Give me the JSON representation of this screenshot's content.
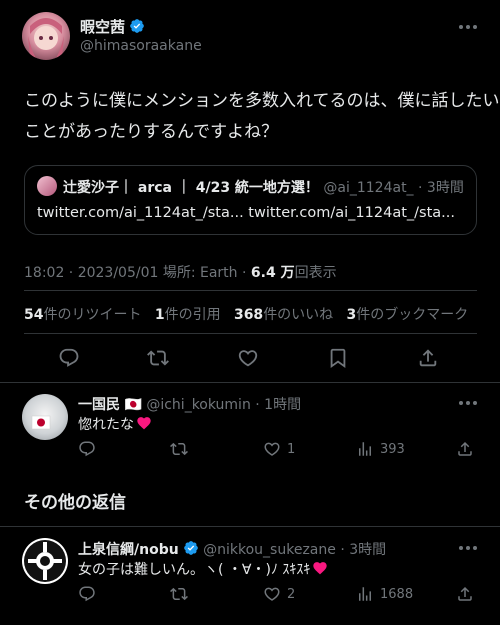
{
  "main_tweet": {
    "display_name": "暇空茜",
    "handle": "@himasoraakane",
    "text_line1": "このように僕にメンションを多数入れてるのは、僕に話したい",
    "text_line2": "ことがあったりするんですよね？",
    "quote": {
      "name": "辻愛沙子｜ arca ｜ 4/23 統一地方選！",
      "handle": "@ai_1124at_",
      "time": "· 3時間",
      "text": "twitter.com/ai_1124at_/sta... twitter.com/ai_1124at_/sta..."
    },
    "meta_time": "18:02 · 2023/05/01 場所: Earth · ",
    "meta_views_count": "6.4 万",
    "meta_views_label": "回表示",
    "stats": {
      "retweets_count": "54",
      "retweets_label": "件のリツイート",
      "quotes_count": "1",
      "quotes_label": "件の引用",
      "likes_count": "368",
      "likes_label": "件のいいね",
      "bookmarks_count": "3",
      "bookmarks_label": "件のブックマーク"
    }
  },
  "reply1": {
    "display_name": "一国民",
    "flag": "🇯🇵",
    "handle": "@ichi_kokumin",
    "time": "· 1時間",
    "text": "惚れたな",
    "likes": "1",
    "views": "393"
  },
  "section_title": "その他の返信",
  "reply2": {
    "display_name": "上泉信綱/nobu",
    "handle": "@nikkou_sukezane",
    "time": "· 3時間",
    "text": "女の子は難しいん。ヽ( ・∀・)ﾉ ｽｷｽｷ",
    "likes": "2",
    "views": "1688"
  },
  "icons": {
    "verified_color": "#1d9bf0",
    "heart_color": "#f91880"
  }
}
